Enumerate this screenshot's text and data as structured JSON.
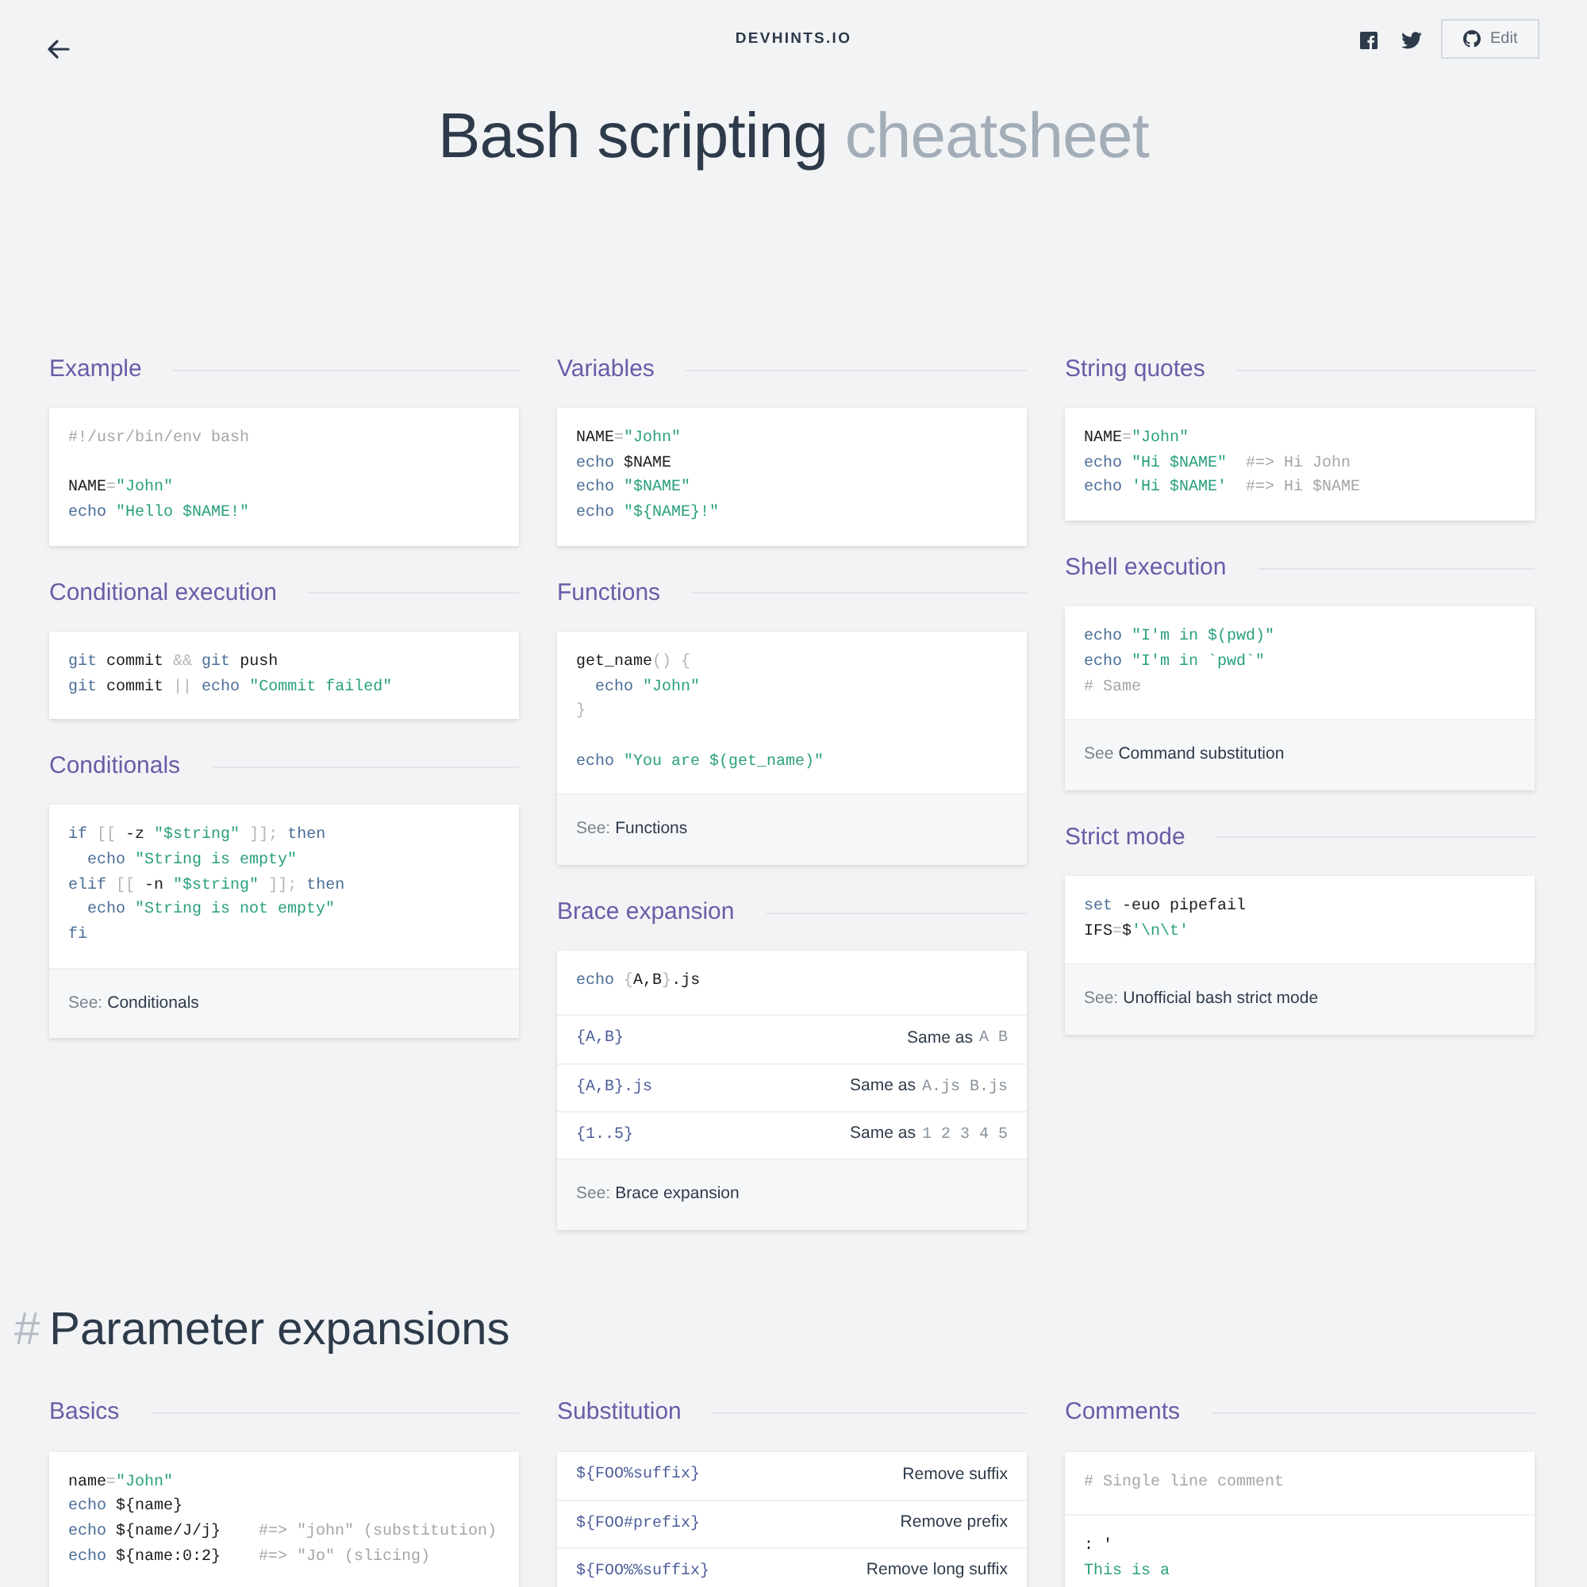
{
  "header": {
    "logo": "DEVHINTS.IO",
    "edit_button": "Edit"
  },
  "title": {
    "main": "Bash scripting",
    "sub": "cheatsheet"
  },
  "groups": [
    {
      "columns": [
        [
          {
            "title": "Example",
            "blocks": [
              {
                "kind": "code",
                "lines": [
                  {
                    "tokens": [
                      {
                        "text": "#!/usr/bin/env bash",
                        "kind": "comment"
                      }
                    ]
                  },
                  {
                    "gap_before": true,
                    "tokens": [
                      {
                        "text": "NAME",
                        "kind": "plain"
                      },
                      {
                        "text": "=",
                        "kind": "punct"
                      },
                      {
                        "text": "\"John\"",
                        "kind": "str"
                      }
                    ]
                  },
                  {
                    "tokens": [
                      {
                        "text": "echo",
                        "kind": "kw"
                      },
                      {
                        "text": " \"Hello $NAME!\"",
                        "kind": "str"
                      }
                    ]
                  }
                ]
              }
            ]
          },
          {
            "title": "Conditional execution",
            "blocks": [
              {
                "kind": "code",
                "lines": [
                  {
                    "tokens": [
                      {
                        "text": "git",
                        "kind": "kw"
                      },
                      {
                        "text": " commit ",
                        "kind": "plain"
                      },
                      {
                        "text": "&&",
                        "kind": "punct"
                      },
                      {
                        "text": " git",
                        "kind": "kw"
                      },
                      {
                        "text": " push",
                        "kind": "plain"
                      }
                    ]
                  },
                  {
                    "tokens": [
                      {
                        "text": "git",
                        "kind": "kw"
                      },
                      {
                        "text": " commit ",
                        "kind": "plain"
                      },
                      {
                        "text": "||",
                        "kind": "punct"
                      },
                      {
                        "text": " echo",
                        "kind": "kw"
                      },
                      {
                        "text": " \"Commit failed\"",
                        "kind": "str"
                      }
                    ]
                  }
                ]
              }
            ]
          },
          {
            "title": "Conditionals",
            "blocks": [
              {
                "kind": "code",
                "lines": [
                  {
                    "tokens": [
                      {
                        "text": "if",
                        "kind": "kw"
                      },
                      {
                        "text": " [[",
                        "kind": "punct"
                      },
                      {
                        "text": " -z ",
                        "kind": "plain"
                      },
                      {
                        "text": "\"$string\"",
                        "kind": "str"
                      },
                      {
                        "text": " ]];",
                        "kind": "punct"
                      },
                      {
                        "text": " then",
                        "kind": "kw"
                      }
                    ]
                  },
                  {
                    "tokens": [
                      {
                        "text": "  echo",
                        "kind": "kw"
                      },
                      {
                        "text": " \"String is empty\"",
                        "kind": "str"
                      }
                    ]
                  },
                  {
                    "tokens": [
                      {
                        "text": "elif",
                        "kind": "kw"
                      },
                      {
                        "text": " [[",
                        "kind": "punct"
                      },
                      {
                        "text": " -n ",
                        "kind": "plain"
                      },
                      {
                        "text": "\"$string\"",
                        "kind": "str"
                      },
                      {
                        "text": " ]];",
                        "kind": "punct"
                      },
                      {
                        "text": " then",
                        "kind": "kw"
                      }
                    ]
                  },
                  {
                    "tokens": [
                      {
                        "text": "  echo",
                        "kind": "kw"
                      },
                      {
                        "text": " \"String is not empty\"",
                        "kind": "str"
                      }
                    ]
                  },
                  {
                    "tokens": [
                      {
                        "text": "fi",
                        "kind": "kw"
                      }
                    ]
                  }
                ]
              },
              {
                "kind": "see",
                "prefix": "See:",
                "link": "Conditionals"
              }
            ]
          }
        ],
        [
          {
            "title": "Variables",
            "blocks": [
              {
                "kind": "code",
                "lines": [
                  {
                    "tokens": [
                      {
                        "text": "NAME",
                        "kind": "plain"
                      },
                      {
                        "text": "=",
                        "kind": "punct"
                      },
                      {
                        "text": "\"John\"",
                        "kind": "str"
                      }
                    ]
                  },
                  {
                    "tokens": [
                      {
                        "text": "echo",
                        "kind": "kw"
                      },
                      {
                        "text": " $NAME",
                        "kind": "plain"
                      }
                    ]
                  },
                  {
                    "tokens": [
                      {
                        "text": "echo",
                        "kind": "kw"
                      },
                      {
                        "text": " \"$NAME\"",
                        "kind": "str"
                      }
                    ]
                  },
                  {
                    "tokens": [
                      {
                        "text": "echo",
                        "kind": "kw"
                      },
                      {
                        "text": " \"${NAME}!\"",
                        "kind": "str"
                      }
                    ]
                  }
                ]
              }
            ]
          },
          {
            "title": "Functions",
            "blocks": [
              {
                "kind": "code",
                "lines": [
                  {
                    "tokens": [
                      {
                        "text": "get_name",
                        "kind": "plain"
                      },
                      {
                        "text": "() {",
                        "kind": "punct"
                      }
                    ]
                  },
                  {
                    "tokens": [
                      {
                        "text": "  echo",
                        "kind": "kw"
                      },
                      {
                        "text": " \"John\"",
                        "kind": "str"
                      }
                    ]
                  },
                  {
                    "tokens": [
                      {
                        "text": "}",
                        "kind": "punct"
                      }
                    ]
                  },
                  {
                    "gap_before": true,
                    "tokens": [
                      {
                        "text": "echo",
                        "kind": "kw"
                      },
                      {
                        "text": " \"You are $(get_name)\"",
                        "kind": "str"
                      }
                    ]
                  }
                ]
              },
              {
                "kind": "see",
                "prefix": "See:",
                "link": "Functions"
              }
            ]
          },
          {
            "title": "Brace expansion",
            "blocks": [
              {
                "kind": "code",
                "lines": [
                  {
                    "tokens": [
                      {
                        "text": "echo",
                        "kind": "kw"
                      },
                      {
                        "text": " {",
                        "kind": "punct"
                      },
                      {
                        "text": "A,B",
                        "kind": "plain"
                      },
                      {
                        "text": "}",
                        "kind": "punct"
                      },
                      {
                        "text": ".js",
                        "kind": "plain"
                      }
                    ]
                  }
                ]
              },
              {
                "kind": "table",
                "rows": [
                  {
                    "code": "{A,B}",
                    "desc": "Same as",
                    "desc_code": "A B"
                  },
                  {
                    "code": "{A,B}.js",
                    "desc": "Same as",
                    "desc_code": "A.js B.js"
                  },
                  {
                    "code": "{1..5}",
                    "desc": "Same as",
                    "desc_code": "1 2 3 4 5"
                  }
                ]
              },
              {
                "kind": "see",
                "prefix": "See:",
                "link": "Brace expansion"
              }
            ]
          }
        ],
        [
          {
            "title": "String quotes",
            "blocks": [
              {
                "kind": "code",
                "lines": [
                  {
                    "tokens": [
                      {
                        "text": "NAME",
                        "kind": "plain"
                      },
                      {
                        "text": "=",
                        "kind": "punct"
                      },
                      {
                        "text": "\"John\"",
                        "kind": "str"
                      }
                    ]
                  },
                  {
                    "tokens": [
                      {
                        "text": "echo",
                        "kind": "kw"
                      },
                      {
                        "text": " \"Hi $NAME\"",
                        "kind": "str"
                      },
                      {
                        "text": "  #=> Hi John",
                        "kind": "comment"
                      }
                    ]
                  },
                  {
                    "tokens": [
                      {
                        "text": "echo",
                        "kind": "kw"
                      },
                      {
                        "text": " 'Hi $NAME'",
                        "kind": "str"
                      },
                      {
                        "text": "  #=> Hi $NAME",
                        "kind": "comment"
                      }
                    ]
                  }
                ]
              }
            ]
          },
          {
            "title": "Shell execution",
            "blocks": [
              {
                "kind": "code",
                "lines": [
                  {
                    "tokens": [
                      {
                        "text": "echo",
                        "kind": "kw"
                      },
                      {
                        "text": " \"I'm in $(pwd)\"",
                        "kind": "str"
                      }
                    ]
                  },
                  {
                    "tokens": [
                      {
                        "text": "echo",
                        "kind": "kw"
                      },
                      {
                        "text": " \"I'm in `pwd`\"",
                        "kind": "str"
                      }
                    ]
                  },
                  {
                    "tokens": [
                      {
                        "text": "# Same",
                        "kind": "comment"
                      }
                    ]
                  }
                ]
              },
              {
                "kind": "see",
                "prefix": "See",
                "link": "Command substitution"
              }
            ]
          },
          {
            "title": "Strict mode",
            "blocks": [
              {
                "kind": "code",
                "lines": [
                  {
                    "tokens": [
                      {
                        "text": "set",
                        "kind": "kw"
                      },
                      {
                        "text": " -euo pipefail",
                        "kind": "plain"
                      }
                    ]
                  },
                  {
                    "tokens": [
                      {
                        "text": "IFS",
                        "kind": "plain"
                      },
                      {
                        "text": "=",
                        "kind": "punct"
                      },
                      {
                        "text": "$",
                        "kind": "plain"
                      },
                      {
                        "text": "'\\n\\t'",
                        "kind": "str"
                      }
                    ]
                  }
                ]
              },
              {
                "kind": "see",
                "prefix": "See:",
                "link": "Unofficial bash strict mode"
              }
            ]
          }
        ]
      ]
    },
    {
      "heading": {
        "hash": "#",
        "text": "Parameter expansions"
      },
      "columns": [
        [
          {
            "title": "Basics",
            "blocks": [
              {
                "kind": "code",
                "lines": [
                  {
                    "tokens": [
                      {
                        "text": "name",
                        "kind": "plain"
                      },
                      {
                        "text": "=",
                        "kind": "punct"
                      },
                      {
                        "text": "\"John\"",
                        "kind": "str"
                      }
                    ]
                  },
                  {
                    "tokens": [
                      {
                        "text": "echo",
                        "kind": "kw"
                      },
                      {
                        "text": " ${name}",
                        "kind": "plain"
                      }
                    ]
                  },
                  {
                    "tokens": [
                      {
                        "text": "echo",
                        "kind": "kw"
                      },
                      {
                        "text": " ${name/J/j}    ",
                        "kind": "plain"
                      },
                      {
                        "text": "#=> \"john\" (substitution)",
                        "kind": "comment"
                      }
                    ]
                  },
                  {
                    "tokens": [
                      {
                        "text": "echo",
                        "kind": "kw"
                      },
                      {
                        "text": " ${name:0:2}    ",
                        "kind": "plain"
                      },
                      {
                        "text": "#=> \"Jo\" (slicing)",
                        "kind": "comment"
                      }
                    ]
                  }
                ]
              }
            ]
          }
        ],
        [
          {
            "title": "Substitution",
            "blocks": [
              {
                "kind": "table",
                "rows": [
                  {
                    "code": "${FOO%suffix}",
                    "desc": "Remove suffix"
                  },
                  {
                    "code": "${FOO#prefix}",
                    "desc": "Remove prefix"
                  },
                  {
                    "code": "${FOO%%suffix}",
                    "desc": "Remove long suffix"
                  }
                ]
              }
            ]
          }
        ],
        [
          {
            "title": "Comments",
            "blocks": [
              {
                "kind": "code",
                "lines": [
                  {
                    "tokens": [
                      {
                        "text": "# Single line comment",
                        "kind": "comment"
                      }
                    ]
                  }
                ]
              },
              {
                "kind": "code",
                "lines": [
                  {
                    "tokens": [
                      {
                        "text": ": '",
                        "kind": "plain"
                      }
                    ]
                  },
                  {
                    "tokens": [
                      {
                        "text": "This is a",
                        "kind": "str"
                      }
                    ]
                  }
                ]
              }
            ]
          }
        ]
      ]
    }
  ]
}
